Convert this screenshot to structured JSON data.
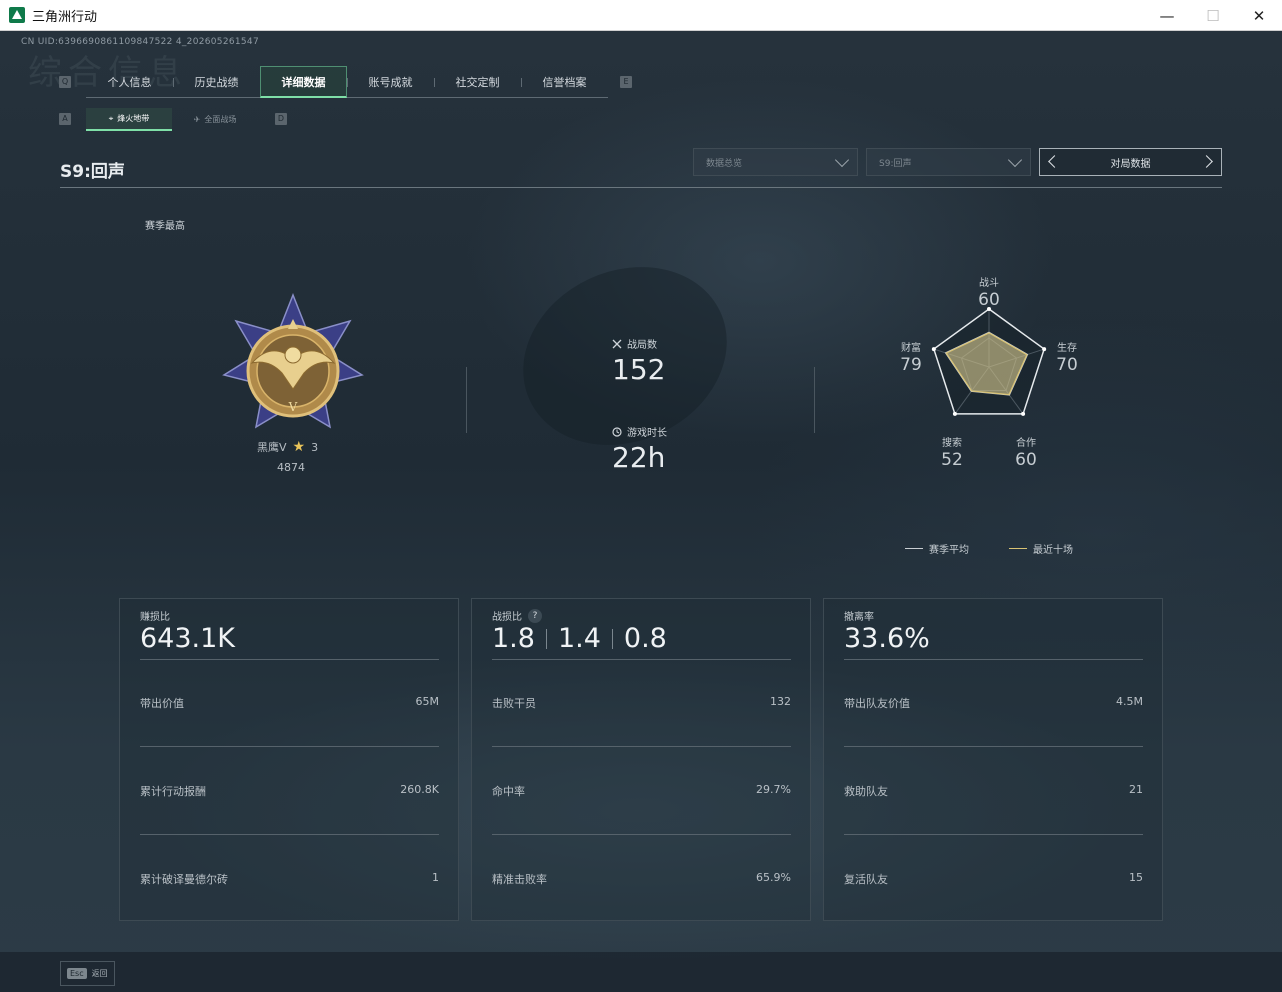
{
  "window": {
    "title": "三角洲行动",
    "minimize": "—",
    "maximize": "☐",
    "close": "✕"
  },
  "uid": "CN UID:6396690861109847522 4_202605261547",
  "bg_title": "综合信息",
  "key_hints": {
    "prev_tab": "Q",
    "next_tab": "E",
    "prev_sub": "A",
    "next_sub": "D"
  },
  "tabs": [
    {
      "label": "个人信息"
    },
    {
      "label": "历史战绩"
    },
    {
      "label": "详细数据"
    },
    {
      "label": "账号成就"
    },
    {
      "label": "社交定制"
    },
    {
      "label": "信誉档案"
    }
  ],
  "subtabs": [
    {
      "label": "烽火地带"
    },
    {
      "label": "全面战场"
    }
  ],
  "season_title": "S9:回声",
  "dropdowns": {
    "data_overview": "数据总览",
    "season": "S9:回声"
  },
  "match_data_button": "对局数据",
  "season_best_label": "赛季最高",
  "rank": {
    "name": "黑鹰V",
    "stars": "3",
    "score": "4874"
  },
  "mid_stats": {
    "matches_label": "战局数",
    "matches_value": "152",
    "playtime_label": "游戏时长",
    "playtime_value": "22h"
  },
  "radar": {
    "combat_label": "战斗",
    "combat_value": "60",
    "survival_label": "生存",
    "survival_value": "70",
    "teamwork_label": "合作",
    "teamwork_value": "60",
    "search_label": "搜索",
    "search_value": "52",
    "wealth_label": "财富",
    "wealth_value": "79",
    "avg_color": "#c9ced2",
    "recent_color": "#d9c373"
  },
  "legend": {
    "season_avg": "赛季平均",
    "recent_ten": "最近十场"
  },
  "cards": [
    {
      "label": "赚损比",
      "big": "643.1K",
      "rows": [
        {
          "label": "带出价值",
          "value": "65M"
        },
        {
          "label": "累计行动报酬",
          "value": "260.8K"
        },
        {
          "label": "累计破译曼德尔砖",
          "value": "1"
        }
      ]
    },
    {
      "label": "战损比",
      "help": "?",
      "big_values": [
        "1.8",
        "1.4",
        "0.8"
      ],
      "rows": [
        {
          "label": "击败干员",
          "value": "132"
        },
        {
          "label": "命中率",
          "value": "29.7%"
        },
        {
          "label": "精准击败率",
          "value": "65.9%"
        }
      ]
    },
    {
      "label": "撤离率",
      "big": "33.6%",
      "rows": [
        {
          "label": "带出队友价值",
          "value": "4.5M"
        },
        {
          "label": "救助队友",
          "value": "21"
        },
        {
          "label": "复活队友",
          "value": "15"
        }
      ]
    }
  ],
  "footer": {
    "esc_key": "Esc",
    "esc_label": "返回"
  }
}
